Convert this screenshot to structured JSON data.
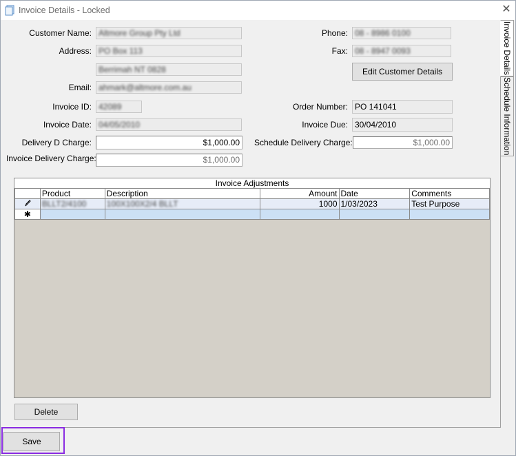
{
  "window": {
    "title": "Invoice Details - Locked",
    "close_glyph": "✕"
  },
  "tabs": [
    {
      "label": "Invoice Details",
      "active": true
    },
    {
      "label": "Schedule Information",
      "active": false
    }
  ],
  "form": {
    "customer_name": {
      "label": "Customer Name:",
      "value": "Altmore Group Pty Ltd"
    },
    "address": {
      "label": "Address:",
      "line1": "PO Box 113",
      "line2": "Berrimah NT 0828"
    },
    "email": {
      "label": "Email:",
      "value": "ahmark@altmore.com.au"
    },
    "phone": {
      "label": "Phone:",
      "value": "08 - 8986 0100"
    },
    "fax": {
      "label": "Fax:",
      "value": "08 - 8947 0093"
    },
    "edit_customer_button": "Edit Customer Details",
    "invoice_id": {
      "label": "Invoice ID:",
      "value": "42089"
    },
    "order_number": {
      "label": "Order Number:",
      "value": "PO 141041"
    },
    "invoice_date": {
      "label": "Invoice Date:",
      "value": "04/05/2010"
    },
    "invoice_due": {
      "label": "Invoice Due:",
      "value": "30/04/2010"
    },
    "delivery_d_charge": {
      "label": "Delivery D Charge:",
      "value": "$1,000.00"
    },
    "schedule_delivery_charge": {
      "label": "Schedule Delivery Charge:",
      "value": "$1,000.00"
    },
    "invoice_delivery_charge": {
      "label": "Invoice Delivery Charge:",
      "value": "$1,000.00"
    }
  },
  "adjustments": {
    "caption": "Invoice Adjustments",
    "columns": [
      "Product",
      "Description",
      "Amount",
      "Date",
      "Comments"
    ],
    "rows": [
      {
        "indicator": "pencil-icon",
        "product": "BLLT2/4100",
        "description": "100X100X2/4 BLLT",
        "amount": "1000",
        "date": "1/03/2023",
        "comments": "Test Purpose"
      }
    ],
    "new_row_glyph": "✱",
    "delete_button": "Delete"
  },
  "footer": {
    "save_button": "Save"
  },
  "colors": {
    "focus_outline": "#8a2be2",
    "grid_background": "#d4d0c8",
    "selected_row": "#cce0f5"
  }
}
